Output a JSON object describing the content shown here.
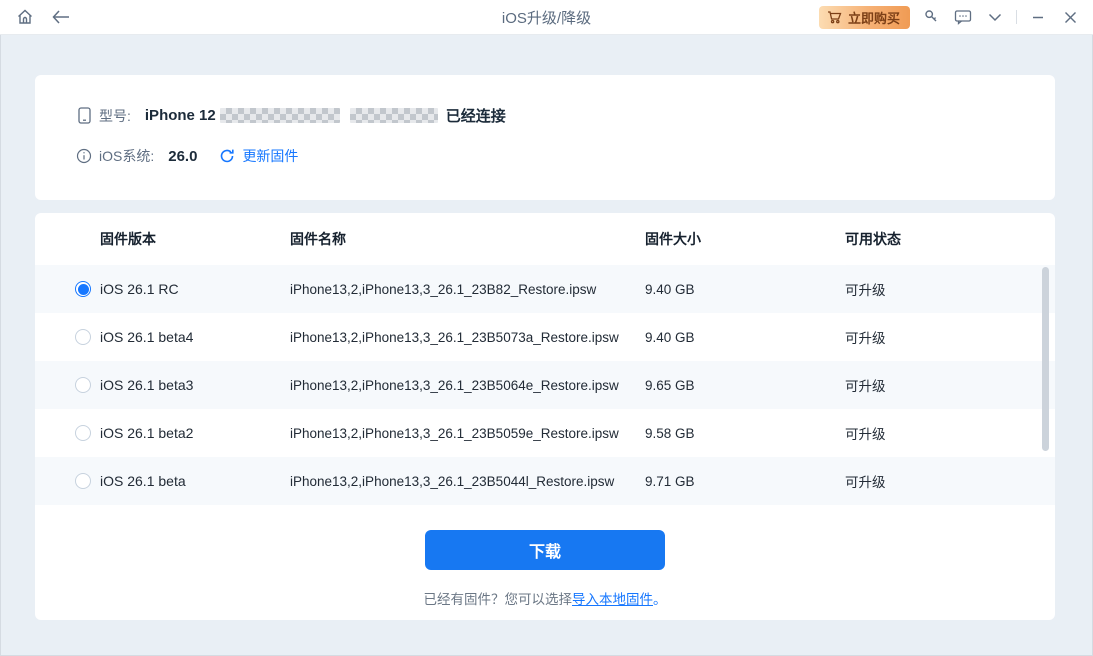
{
  "titlebar": {
    "title": "iOS升级/降级",
    "buy_button_label": "立即购买"
  },
  "device": {
    "model_label": "型号:",
    "model_name": "iPhone 12",
    "connect_status": "已经连接",
    "ios_label": "iOS系统:",
    "ios_version": "26.0",
    "update_firmware_link": "更新固件"
  },
  "table": {
    "headers": [
      "固件版本",
      "固件名称",
      "固件大小",
      "可用状态"
    ],
    "rows": [
      {
        "version": "iOS 26.1 RC",
        "name": "iPhone13,2,iPhone13,3_26.1_23B82_Restore.ipsw",
        "size": "9.40 GB",
        "status": "可升级",
        "selected": true
      },
      {
        "version": "iOS 26.1 beta4",
        "name": "iPhone13,2,iPhone13,3_26.1_23B5073a_Restore.ipsw",
        "size": "9.40 GB",
        "status": "可升级",
        "selected": false
      },
      {
        "version": "iOS 26.1 beta3",
        "name": "iPhone13,2,iPhone13,3_26.1_23B5064e_Restore.ipsw",
        "size": "9.65 GB",
        "status": "可升级",
        "selected": false
      },
      {
        "version": "iOS 26.1 beta2",
        "name": "iPhone13,2,iPhone13,3_26.1_23B5059e_Restore.ipsw",
        "size": "9.58 GB",
        "status": "可升级",
        "selected": false
      },
      {
        "version": "iOS 26.1 beta",
        "name": "iPhone13,2,iPhone13,3_26.1_23B5044l_Restore.ipsw",
        "size": "9.71 GB",
        "status": "可升级",
        "selected": false
      }
    ]
  },
  "footer": {
    "download_label": "下载",
    "hint_text": "已经有固件？您可以选择",
    "hint_link": "导入本地固件",
    "hint_end": "。"
  },
  "colors": {
    "accent_blue": "#1677ff",
    "download_blue": "#1778f2",
    "buy_gradient_start": "#fcdcb2",
    "buy_gradient_end": "#f09b54",
    "buy_text": "#7c3f16",
    "page_background": "#e9eff5",
    "row_alt": "#f6f9fc"
  }
}
